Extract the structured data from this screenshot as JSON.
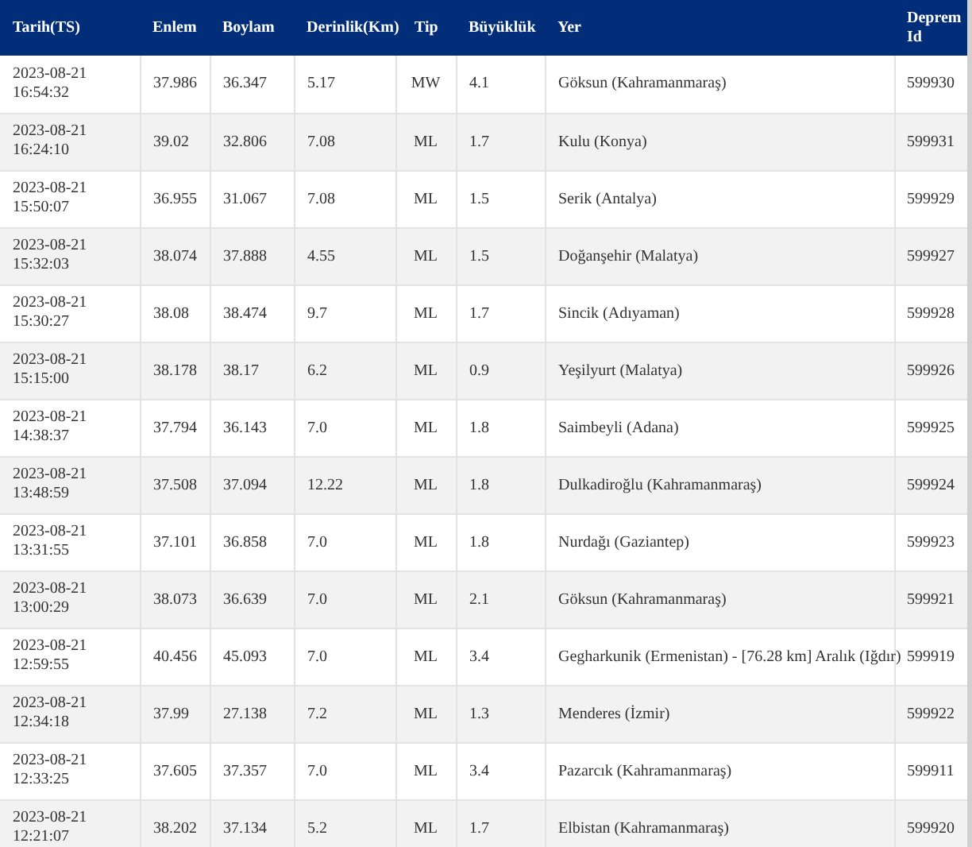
{
  "table": {
    "columns": [
      "Tarih(TS)",
      "Enlem",
      "Boylam",
      "Derinlik(Km)",
      "Tip",
      "Büyüklük",
      "Yer",
      "Deprem Id"
    ],
    "rows": [
      {
        "date": "2023-08-21",
        "time": "16:54:32",
        "lat": "37.986",
        "lon": "36.347",
        "depth": "5.17",
        "type": "MW",
        "mag": "4.1",
        "place": "Göksun (Kahramanmaraş)",
        "id": "599930"
      },
      {
        "date": "2023-08-21",
        "time": "16:24:10",
        "lat": "39.02",
        "lon": "32.806",
        "depth": "7.08",
        "type": "ML",
        "mag": "1.7",
        "place": "Kulu (Konya)",
        "id": "599931"
      },
      {
        "date": "2023-08-21",
        "time": "15:50:07",
        "lat": "36.955",
        "lon": "31.067",
        "depth": "7.08",
        "type": "ML",
        "mag": "1.5",
        "place": "Serik (Antalya)",
        "id": "599929"
      },
      {
        "date": "2023-08-21",
        "time": "15:32:03",
        "lat": "38.074",
        "lon": "37.888",
        "depth": "4.55",
        "type": "ML",
        "mag": "1.5",
        "place": "Doğanşehir (Malatya)",
        "id": "599927"
      },
      {
        "date": "2023-08-21",
        "time": "15:30:27",
        "lat": "38.08",
        "lon": "38.474",
        "depth": "9.7",
        "type": "ML",
        "mag": "1.7",
        "place": "Sincik (Adıyaman)",
        "id": "599928"
      },
      {
        "date": "2023-08-21",
        "time": "15:15:00",
        "lat": "38.178",
        "lon": "38.17",
        "depth": "6.2",
        "type": "ML",
        "mag": "0.9",
        "place": "Yeşilyurt (Malatya)",
        "id": "599926"
      },
      {
        "date": "2023-08-21",
        "time": "14:38:37",
        "lat": "37.794",
        "lon": "36.143",
        "depth": "7.0",
        "type": "ML",
        "mag": "1.8",
        "place": "Saimbeyli (Adana)",
        "id": "599925"
      },
      {
        "date": "2023-08-21",
        "time": "13:48:59",
        "lat": "37.508",
        "lon": "37.094",
        "depth": "12.22",
        "type": "ML",
        "mag": "1.8",
        "place": "Dulkadiroğlu (Kahramanmaraş)",
        "id": "599924"
      },
      {
        "date": "2023-08-21",
        "time": "13:31:55",
        "lat": "37.101",
        "lon": "36.858",
        "depth": "7.0",
        "type": "ML",
        "mag": "1.8",
        "place": "Nurdağı (Gaziantep)",
        "id": "599923"
      },
      {
        "date": "2023-08-21",
        "time": "13:00:29",
        "lat": "38.073",
        "lon": "36.639",
        "depth": "7.0",
        "type": "ML",
        "mag": "2.1",
        "place": "Göksun (Kahramanmaraş)",
        "id": "599921"
      },
      {
        "date": "2023-08-21",
        "time": "12:59:55",
        "lat": "40.456",
        "lon": "45.093",
        "depth": "7.0",
        "type": "ML",
        "mag": "3.4",
        "place": "Gegharkunik (Ermenistan) - [76.28 km] Aralık (Iğdır)",
        "id": "599919"
      },
      {
        "date": "2023-08-21",
        "time": "12:34:18",
        "lat": "37.99",
        "lon": "27.138",
        "depth": "7.2",
        "type": "ML",
        "mag": "1.3",
        "place": "Menderes (İzmir)",
        "id": "599922"
      },
      {
        "date": "2023-08-21",
        "time": "12:33:25",
        "lat": "37.605",
        "lon": "37.357",
        "depth": "7.0",
        "type": "ML",
        "mag": "3.4",
        "place": "Pazarcık (Kahramanmaraş)",
        "id": "599911"
      },
      {
        "date": "2023-08-21",
        "time": "12:21:07",
        "lat": "38.202",
        "lon": "37.134",
        "depth": "5.2",
        "type": "ML",
        "mag": "1.7",
        "place": "Elbistan (Kahramanmaraş)",
        "id": "599920"
      }
    ]
  }
}
